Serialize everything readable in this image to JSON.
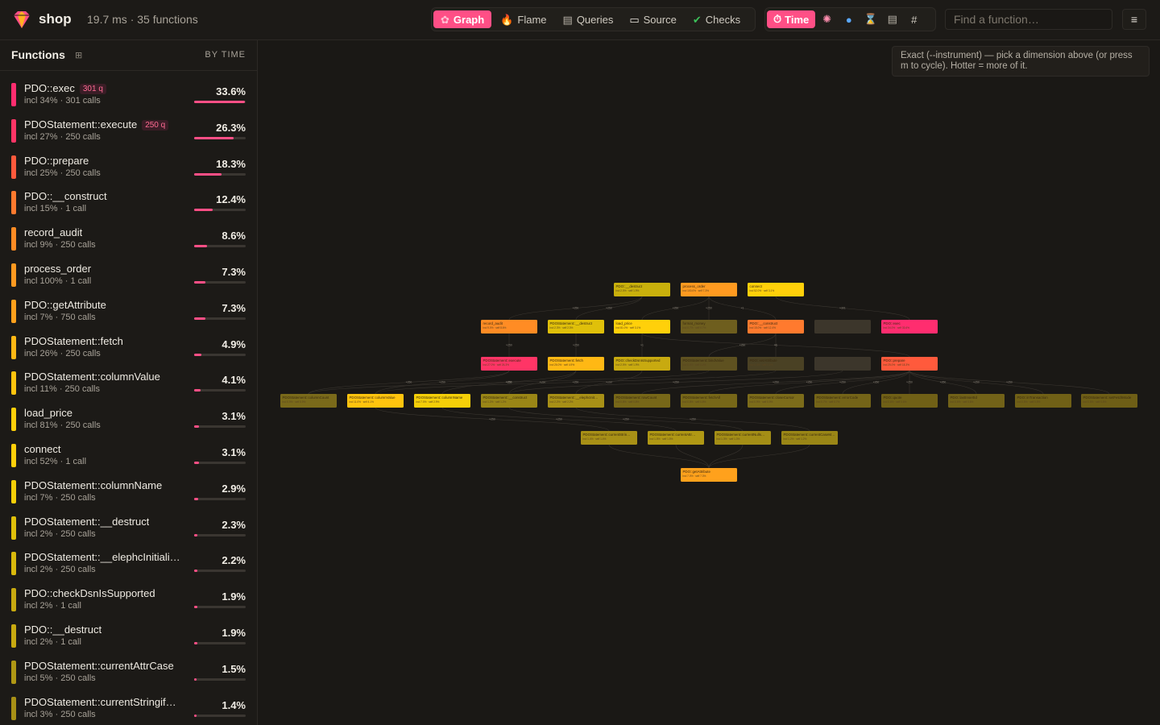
{
  "app": {
    "name": "shop",
    "stats": "19.7 ms · 35 functions"
  },
  "view_tabs": [
    {
      "label": "Graph",
      "icon": "graph-icon",
      "active": true
    },
    {
      "label": "Flame",
      "icon": "fire-icon",
      "active": false
    },
    {
      "label": "Queries",
      "icon": "database-icon",
      "active": false
    },
    {
      "label": "Source",
      "icon": "document-icon",
      "active": false
    },
    {
      "label": "Checks",
      "icon": "check-icon",
      "active": false
    }
  ],
  "dimensions": [
    {
      "label": "Time",
      "icon": "stopwatch-icon",
      "active": true
    },
    {
      "label": "",
      "icon": "brain-icon",
      "active": false
    },
    {
      "label": "",
      "icon": "droplet-icon",
      "active": false
    },
    {
      "label": "",
      "icon": "hourglass-icon",
      "active": false
    },
    {
      "label": "",
      "icon": "database-icon",
      "active": false
    },
    {
      "label": "#",
      "icon": "hash-icon",
      "active": false
    }
  ],
  "search": {
    "placeholder": "Find a function…"
  },
  "menu": {
    "label": "≡"
  },
  "sidebar": {
    "title": "Functions",
    "grid_toggle": "⊞",
    "sort_label": "BY TIME",
    "items": [
      {
        "name": "PDO::exec",
        "badge": "301 q",
        "sub": "incl 34% · 301 calls",
        "pct": "33.6%",
        "share": 33.6,
        "color": "#ff2d6f"
      },
      {
        "name": "PDOStatement::execute",
        "badge": "250 q",
        "sub": "incl 27% · 250 calls",
        "pct": "26.3%",
        "share": 26.3,
        "color": "#ff3566"
      },
      {
        "name": "PDO::prepare",
        "badge": "",
        "sub": "incl 25% · 250 calls",
        "pct": "18.3%",
        "share": 18.3,
        "color": "#ff5a3c"
      },
      {
        "name": "PDO::__construct",
        "badge": "",
        "sub": "incl 15% · 1 call",
        "pct": "12.4%",
        "share": 12.4,
        "color": "#ff7a2e"
      },
      {
        "name": "record_audit",
        "badge": "",
        "sub": "incl 9% · 250 calls",
        "pct": "8.6%",
        "share": 8.6,
        "color": "#ff8c24"
      },
      {
        "name": "process_order",
        "badge": "",
        "sub": "incl 100% · 1 call",
        "pct": "7.3%",
        "share": 7.3,
        "color": "#ff9a20"
      },
      {
        "name": "PDO::getAttribute",
        "badge": "",
        "sub": "incl 7% · 750 calls",
        "pct": "7.3%",
        "share": 7.3,
        "color": "#ffa11c"
      },
      {
        "name": "PDOStatement::fetch",
        "badge": "",
        "sub": "incl 26% · 250 calls",
        "pct": "4.9%",
        "share": 4.9,
        "color": "#ffb814"
      },
      {
        "name": "PDOStatement::columnValue",
        "badge": "",
        "sub": "incl 11% · 250 calls",
        "pct": "4.1%",
        "share": 4.1,
        "color": "#ffc40e"
      },
      {
        "name": "load_price",
        "badge": "",
        "sub": "incl 81% · 250 calls",
        "pct": "3.1%",
        "share": 3.1,
        "color": "#ffd00a"
      },
      {
        "name": "connect",
        "badge": "",
        "sub": "incl 52% · 1 call",
        "pct": "3.1%",
        "share": 3.1,
        "color": "#ffd00a"
      },
      {
        "name": "PDOStatement::columnName",
        "badge": "",
        "sub": "incl 7% · 250 calls",
        "pct": "2.9%",
        "share": 2.9,
        "color": "#f5cf08"
      },
      {
        "name": "PDOStatement::__destruct",
        "badge": "",
        "sub": "incl 2% · 250 calls",
        "pct": "2.3%",
        "share": 2.3,
        "color": "#e0c00a"
      },
      {
        "name": "PDOStatement::__elephcInitiali…",
        "badge": "",
        "sub": "incl 2% · 250 calls",
        "pct": "2.2%",
        "share": 2.2,
        "color": "#d9b90c"
      },
      {
        "name": "PDO::checkDsnIsSupported",
        "badge": "",
        "sub": "incl 2% · 1 call",
        "pct": "1.9%",
        "share": 1.9,
        "color": "#c8aa10"
      },
      {
        "name": "PDO::__destruct",
        "badge": "",
        "sub": "incl 2% · 1 call",
        "pct": "1.9%",
        "share": 1.9,
        "color": "#c8aa10"
      },
      {
        "name": "PDOStatement::currentAttrCase",
        "badge": "",
        "sub": "incl 5% · 250 calls",
        "pct": "1.5%",
        "share": 1.5,
        "color": "#b09814"
      },
      {
        "name": "PDOStatement::currentStringif…",
        "badge": "",
        "sub": "incl 3% · 250 calls",
        "pct": "1.4%",
        "share": 1.4,
        "color": "#a89016"
      }
    ]
  },
  "hint": "Exact (--instrument) — pick a dimension above (or press m to cycle). Hotter = more of it.",
  "graph": {
    "nodes": [
      {
        "name": "PDO::__destruct",
        "sub": "incl 2.0% · self 1.9%",
        "color": "#c9b00c"
      },
      {
        "name": "process_order",
        "sub": "incl 100.0% · self 7.3%",
        "color": "#ff9a20"
      },
      {
        "name": "connect",
        "sub": "incl 52.0% · self 3.1%",
        "color": "#ffd00a"
      },
      {
        "name": "record_audit",
        "sub": "incl 9.0% · self 8.6%",
        "color": "#ff8c24"
      },
      {
        "name": "PDOStatement::__destruct",
        "sub": "incl 2.3% · self 2.3%",
        "color": "#e0c00a"
      },
      {
        "name": "load_price",
        "sub": "incl 81.0% · self 3.1%",
        "color": "#ffd00a"
      },
      {
        "name": "format_money",
        "sub": "incl 0.7% · self 0.7%",
        "color": "#6e5e1e"
      },
      {
        "name": "PDO::__construct",
        "sub": "incl 15.0% · self 12.4%",
        "color": "#ff7a2e"
      },
      {
        "name": "",
        "sub": "",
        "color": "#3c362b"
      },
      {
        "name": "PDO::exec",
        "sub": "incl 34.0% · self 33.6%",
        "color": "#ff2d6f"
      },
      {
        "name": "PDOStatement::execute",
        "sub": "incl 27.0% · self 26.3%",
        "color": "#ff3566"
      },
      {
        "name": "PDOStatement::fetch",
        "sub": "incl 26.0% · self 4.9%",
        "color": "#ffb814"
      },
      {
        "name": "PDO::checkDsnIsSupported",
        "sub": "incl 2.0% · self 1.9%",
        "color": "#c8aa10"
      },
      {
        "name": "PDOStatement::bindValue",
        "sub": "incl 0.6% · self 0.6%",
        "color": "#5e5120"
      },
      {
        "name": "PDO::setAttribute",
        "sub": "incl 0.4% · self 0.4%",
        "color": "#4a4124"
      },
      {
        "name": "",
        "sub": "",
        "color": "#3c362b"
      },
      {
        "name": "PDO::prepare",
        "sub": "incl 25.0% · self 18.3%",
        "color": "#ff5a3c"
      },
      {
        "name": "PDOStatement::columnCount",
        "sub": "incl 0.9% · self 0.9%",
        "color": "#7a6a1a"
      },
      {
        "name": "PDOStatement::columnValue",
        "sub": "incl 11.0% · self 4.1%",
        "color": "#ffc40e"
      },
      {
        "name": "PDOStatement::columnName",
        "sub": "incl 7.0% · self 2.9%",
        "color": "#f5cf08"
      },
      {
        "name": "PDOStatement::__construct",
        "sub": "incl 1.2% · self 1.2%",
        "color": "#9a8616"
      },
      {
        "name": "PDOStatement::__elephcInit…",
        "sub": "incl 2.2% · self 2.2%",
        "color": "#a89016"
      },
      {
        "name": "PDOStatement::rowCount",
        "sub": "incl 0.8% · self 0.8%",
        "color": "#776718"
      },
      {
        "name": "PDOStatement::fetchAll",
        "sub": "incl 0.8% · self 0.8%",
        "color": "#776718"
      },
      {
        "name": "PDOStatement::closeCursor",
        "sub": "incl 0.9% · self 0.9%",
        "color": "#7c6c1a"
      },
      {
        "name": "PDOStatement::errorCode",
        "sub": "incl 0.7% · self 0.7%",
        "color": "#746418"
      },
      {
        "name": "PDO::quote",
        "sub": "incl 0.6% · self 0.6%",
        "color": "#706016"
      },
      {
        "name": "PDO::lastInsertId",
        "sub": "incl 0.6% · self 0.6%",
        "color": "#726218"
      },
      {
        "name": "PDO::inTransaction",
        "sub": "incl 0.5% · self 0.5%",
        "color": "#706016"
      },
      {
        "name": "PDOStatement::setFetchMode",
        "sub": "incl 0.5% · self 0.5%",
        "color": "#6e5e16"
      },
      {
        "name": "PDOStatement::currentStrin…",
        "sub": "incl 1.4% · self 1.4%",
        "color": "#a89016"
      },
      {
        "name": "PDOStatement::currentAttr…",
        "sub": "incl 1.5% · self 1.5%",
        "color": "#b09814"
      },
      {
        "name": "PDOStatement::currentNulls…",
        "sub": "incl 1.3% · self 1.3%",
        "color": "#a48e16"
      },
      {
        "name": "PDOStatement::currentCaseM…",
        "sub": "incl 1.2% · self 1.2%",
        "color": "#9a8616"
      },
      {
        "name": "PDO::getAttribute",
        "sub": "incl 7.0% · self 7.3%",
        "color": "#ffa11c"
      }
    ],
    "edges": [
      {
        "label": "×250"
      },
      {
        "label": "×250"
      },
      {
        "label": "×250"
      },
      {
        "label": "×250"
      },
      {
        "label": "×1"
      },
      {
        "label": "×301"
      },
      {
        "label": "×250"
      },
      {
        "label": "×250"
      },
      {
        "label": "×1"
      },
      {
        "label": "×1"
      },
      {
        "label": "×250"
      },
      {
        "label": "×1"
      },
      {
        "label": "×250"
      },
      {
        "label": "×250"
      },
      {
        "label": "×250"
      },
      {
        "label": "×250"
      },
      {
        "label": "×250"
      },
      {
        "label": "×250"
      },
      {
        "label": "×250"
      },
      {
        "label": "×250"
      },
      {
        "label": "×250"
      },
      {
        "label": "×250"
      },
      {
        "label": "×250"
      },
      {
        "label": "×250"
      },
      {
        "label": "×250"
      },
      {
        "label": "×250"
      },
      {
        "label": "×250"
      },
      {
        "label": "×250"
      },
      {
        "label": "×250"
      },
      {
        "label": "×250"
      },
      {
        "label": "×250"
      },
      {
        "label": "×250"
      }
    ]
  }
}
